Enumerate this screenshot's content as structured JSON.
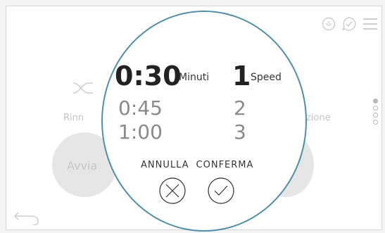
{
  "background": {
    "left_label": "Rinn",
    "right_label": "zione",
    "left_button_text": "Avvia"
  },
  "top_icons": [
    "power-icon",
    "check-chat-icon",
    "menu-icon"
  ],
  "page_dots": {
    "count": 4,
    "active_index": 0
  },
  "picker": {
    "minutes": {
      "selected": "0:30",
      "unit_label": "Minuti",
      "options": [
        "0:45",
        "1:00"
      ]
    },
    "speed": {
      "selected": "1",
      "unit_label": "Speed",
      "options": [
        "2",
        "3"
      ]
    }
  },
  "actions": {
    "cancel_label": "ANNULLA",
    "confirm_label": "CONFERMA"
  },
  "colors": {
    "accent": "#4f8eaa",
    "muted": "#8a8a8a",
    "bg_disabled": "#e6e6e6"
  }
}
